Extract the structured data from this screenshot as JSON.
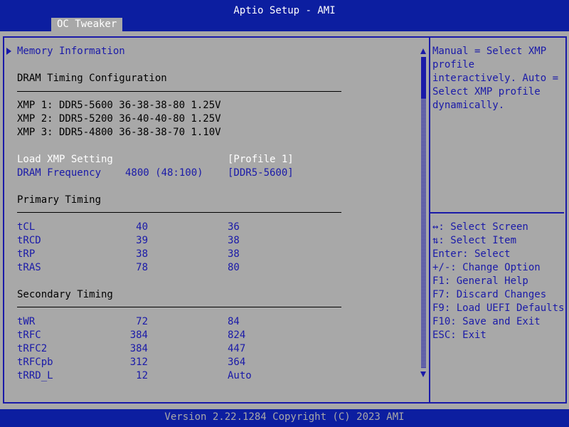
{
  "title": "Aptio Setup - AMI",
  "tab": "OC Tweaker",
  "menu": {
    "memory_information": "Memory Information",
    "dram_timing_heading": "DRAM Timing Configuration",
    "xmp_profiles": [
      "XMP 1: DDR5-5600 36-38-38-80 1.25V",
      "XMP 2: DDR5-5200 36-40-40-80 1.25V",
      "XMP 3: DDR5-4800 36-38-38-70 1.10V"
    ],
    "load_xmp": {
      "label": "Load XMP Setting",
      "value": "[Profile 1]"
    },
    "dram_frequency": {
      "label": "DRAM Frequency",
      "current": "4800 (48:100)",
      "value": "[DDR5-5600]"
    },
    "primary_heading": "Primary Timing",
    "primary": [
      {
        "name": "tCL",
        "current": "40",
        "value": "36"
      },
      {
        "name": "tRCD",
        "current": "39",
        "value": "38"
      },
      {
        "name": "tRP",
        "current": "38",
        "value": "38"
      },
      {
        "name": "tRAS",
        "current": "78",
        "value": "80"
      }
    ],
    "secondary_heading": "Secondary Timing",
    "secondary": [
      {
        "name": "tWR",
        "current": "72",
        "value": "84"
      },
      {
        "name": "tRFC",
        "current": "384",
        "value": "824"
      },
      {
        "name": "tRFC2",
        "current": "384",
        "value": "447"
      },
      {
        "name": "tRFCpb",
        "current": "312",
        "value": "364"
      },
      {
        "name": "tRRD_L",
        "current": "12",
        "value": "Auto"
      }
    ]
  },
  "help": {
    "description": "Manual = Select XMP profile interactively. Auto = Select XMP profile dynamically.",
    "keys": [
      "↔: Select Screen",
      "⇅: Select Item",
      "Enter: Select",
      "+/-: Change Option",
      "F1: General Help",
      "F7: Discard Changes",
      "F9: Load UEFI Defaults",
      "F10: Save and Exit",
      "ESC: Exit"
    ]
  },
  "footer": "Version 2.22.1284 Copyright (C) 2023 AMI"
}
